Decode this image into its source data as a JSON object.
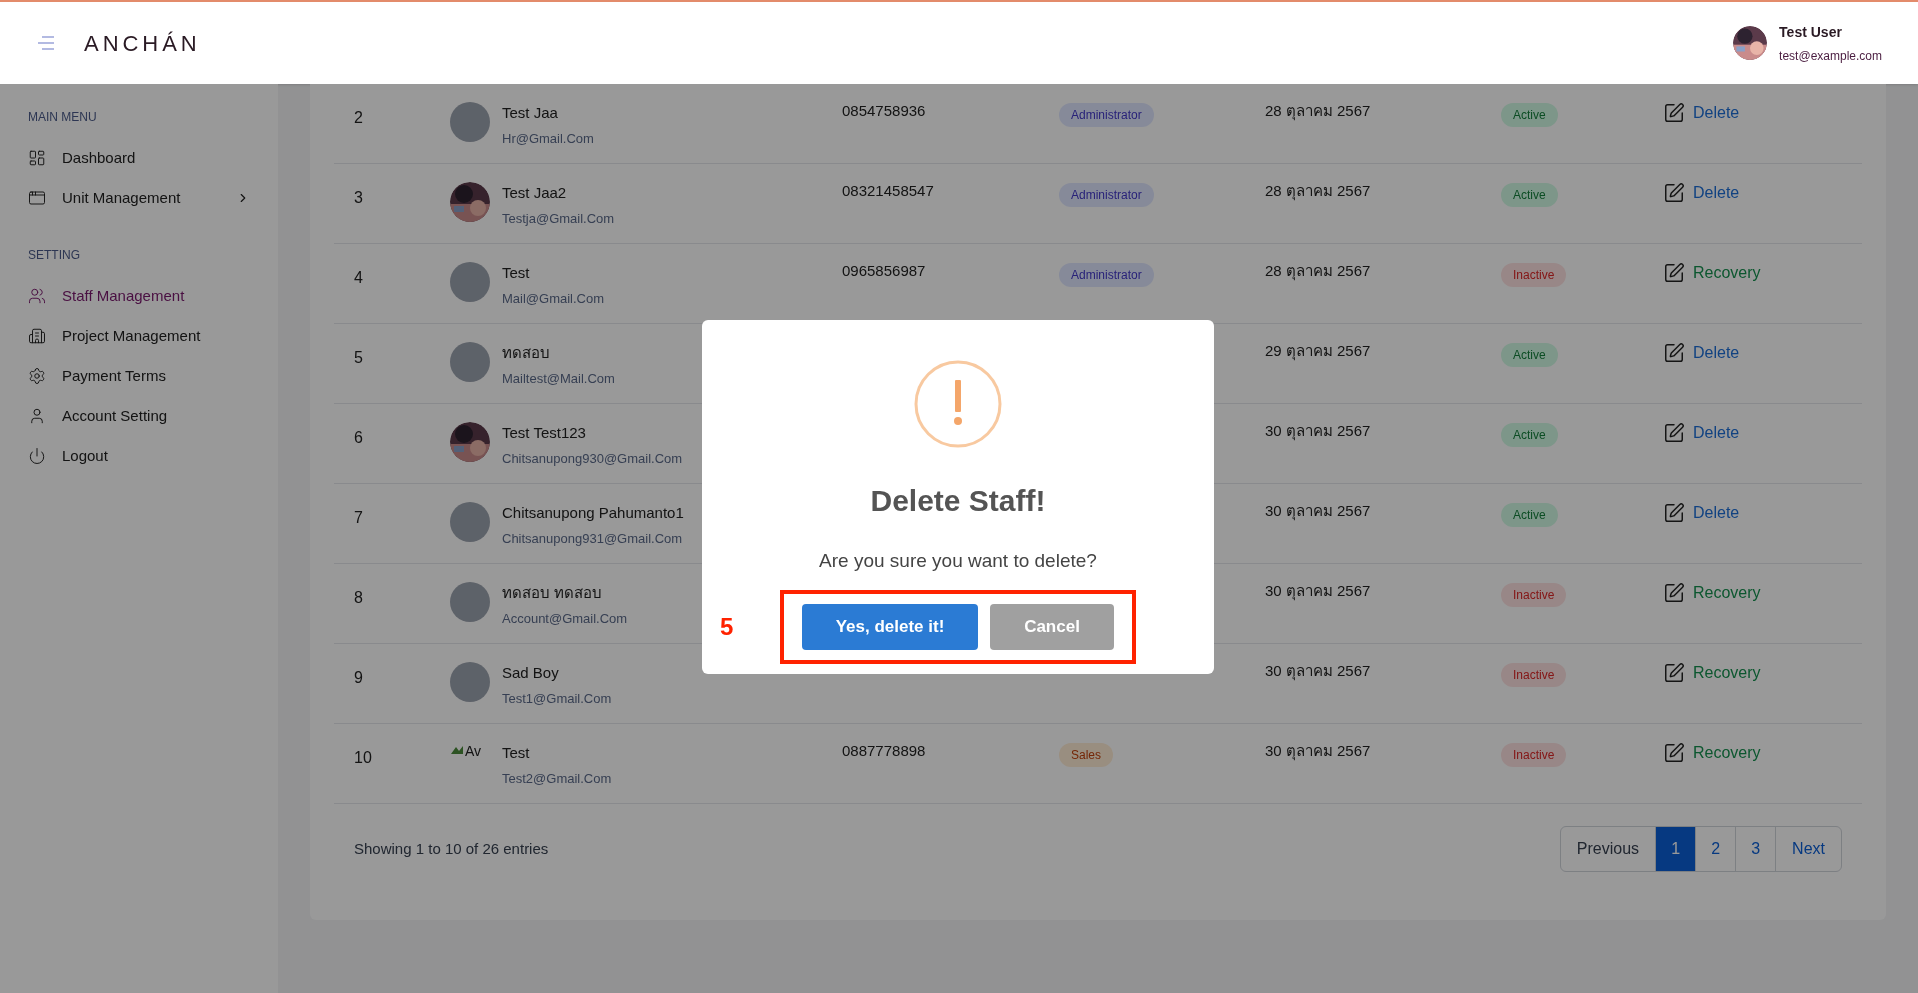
{
  "header": {
    "logo": "ANCHÁN",
    "user": {
      "name": "Test User",
      "email": "test@example.com"
    }
  },
  "sidebar": {
    "sections": [
      {
        "title": "MAIN MENU",
        "items": [
          {
            "label": "Dashboard",
            "selected": false
          },
          {
            "label": "Unit Management",
            "selected": false,
            "expanded": false
          }
        ]
      },
      {
        "title": "SETTING",
        "items": [
          {
            "label": "Staff Management",
            "selected": true
          },
          {
            "label": "Project Management",
            "selected": false
          },
          {
            "label": "Payment Terms",
            "selected": false
          },
          {
            "label": "Account Setting",
            "selected": false
          },
          {
            "label": "Logout",
            "selected": false
          }
        ]
      }
    ]
  },
  "table": {
    "rows": [
      {
        "no": "2",
        "avatar": {
          "kind": "placeholder"
        },
        "name": "Test Jaa",
        "email": "Hr@Gmail.Com",
        "phone": "0854758936",
        "role": {
          "label": "Administrator",
          "kind": "admin"
        },
        "date": "28 ตุลาคม 2567",
        "status": {
          "label": "Active",
          "active": true
        },
        "action": {
          "label": "Delete",
          "kind": "delete"
        }
      },
      {
        "no": "3",
        "name": "Test Jaa2",
        "email": "Testja@Gmail.Com",
        "phone": "08321458547",
        "role": {
          "label": "Administrator",
          "kind": "admin"
        },
        "date": "28 ตุลาคม 2567",
        "status": {
          "label": "Active",
          "active": true
        },
        "action": {
          "label": "Delete",
          "kind": "delete"
        }
      },
      {
        "no": "4",
        "avatar": {
          "kind": "placeholder"
        },
        "name": "Test",
        "email": "Mail@Gmail.Com",
        "phone": "0965856987",
        "role": {
          "label": "Administrator",
          "kind": "admin"
        },
        "date": "28 ตุลาคม 2567",
        "status": {
          "label": "Inactive",
          "active": false
        },
        "action": {
          "label": "Recovery",
          "kind": "recovery"
        }
      },
      {
        "no": "5",
        "avatar": {
          "kind": "placeholder"
        },
        "name": "ทดสอบ",
        "email": "Mailtest@Mail.Com",
        "date": "29 ตุลาคม 2567",
        "status": {
          "label": "Active",
          "active": true
        },
        "action": {
          "label": "Delete",
          "kind": "delete"
        }
      },
      {
        "no": "6",
        "name": "Test Test123",
        "email": "Chitsanupong930@Gmail.Com",
        "date": "30 ตุลาคม 2567",
        "status": {
          "label": "Active",
          "active": true
        },
        "action": {
          "label": "Delete",
          "kind": "delete"
        }
      },
      {
        "no": "7",
        "avatar": {
          "kind": "placeholder"
        },
        "name": "Chitsanupong Pahumanto1",
        "email": "Chitsanupong931@Gmail.Com",
        "date": "30 ตุลาคม 2567",
        "status": {
          "label": "Active",
          "active": true
        },
        "action": {
          "label": "Delete",
          "kind": "delete"
        }
      },
      {
        "no": "8",
        "avatar": {
          "kind": "placeholder"
        },
        "name": "ทดสอบ ทดสอบ",
        "email": "Account@Gmail.Com",
        "date": "30 ตุลาคม 2567",
        "status": {
          "label": "Inactive",
          "active": false
        },
        "action": {
          "label": "Recovery",
          "kind": "recovery"
        }
      },
      {
        "no": "9",
        "avatar": {
          "kind": "placeholder"
        },
        "name": "Sad Boy",
        "email": "Test1@Gmail.Com",
        "date": "30 ตุลาคม 2567",
        "status": {
          "label": "Inactive",
          "active": false
        },
        "action": {
          "label": "Recovery",
          "kind": "recovery"
        }
      },
      {
        "no": "10",
        "avatar": {
          "kind": "broken",
          "alt": "Av"
        },
        "name": "Test",
        "email": "Test2@Gmail.Com",
        "phone": "0887778898",
        "role": {
          "label": "Sales",
          "kind": "sales"
        },
        "date": "30 ตุลาคม 2567",
        "status": {
          "label": "Inactive",
          "active": false
        },
        "action": {
          "label": "Recovery",
          "kind": "recovery"
        }
      }
    ]
  },
  "footer": {
    "summary": "Showing 1 to 10 of 26 entries",
    "pagination": {
      "previous": "Previous",
      "pages": [
        {
          "label": "1",
          "selected": true
        },
        {
          "label": "2",
          "selected": false
        },
        {
          "label": "3",
          "selected": false
        }
      ],
      "next": "Next"
    }
  },
  "dialog": {
    "title": "Delete Staff!",
    "message": "Are you sure you want to delete?",
    "confirm": "Yes, delete it!",
    "cancel": "Cancel",
    "annotation": {
      "label": "5"
    }
  }
}
